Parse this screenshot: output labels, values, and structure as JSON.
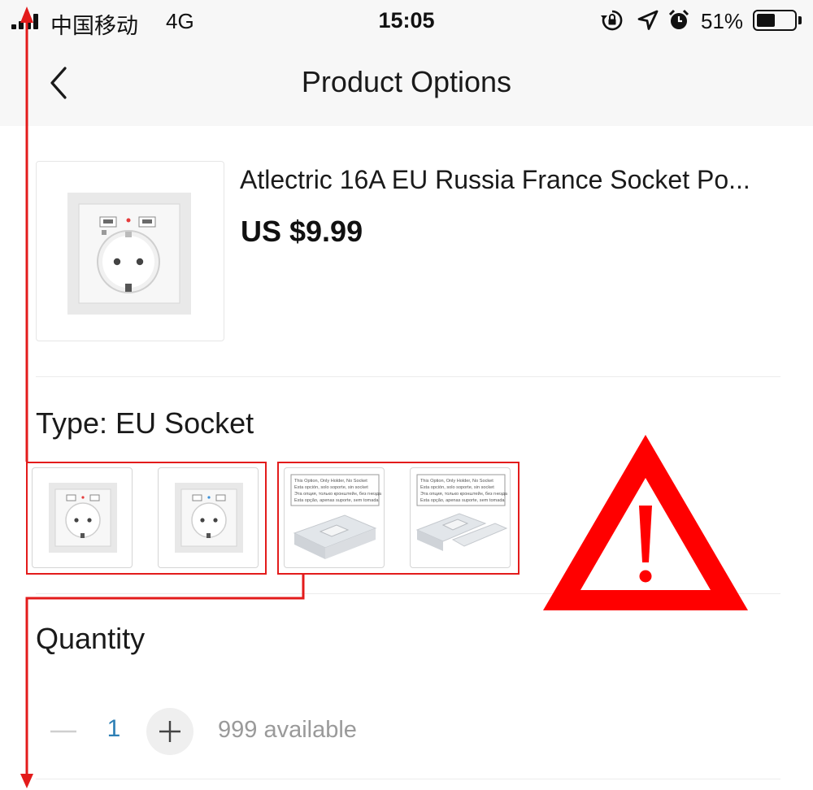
{
  "status_bar": {
    "carrier": "中国移动",
    "network": "4G",
    "time": "15:05",
    "battery_percent": "51%",
    "battery_level": 0.51,
    "icons": [
      "signal-icon",
      "rotation-lock-icon",
      "location-arrow-icon",
      "alarm-icon",
      "battery-icon"
    ]
  },
  "nav": {
    "title": "Product Options",
    "back_icon": "chevron-left-icon"
  },
  "product": {
    "title": "Atlectric 16A EU Russia France Socket Po...",
    "price": "US $9.99"
  },
  "type_selector": {
    "label": "Type: EU Socket",
    "options": [
      {
        "kind": "socket",
        "name": "option-eu-socket-1"
      },
      {
        "kind": "socket",
        "name": "option-eu-socket-2"
      },
      {
        "kind": "holder",
        "name": "option-holder-only-1",
        "notice_lines": [
          "This Option, Only Holder, No Socket",
          "Esta opción, solo soporte, sin socket",
          "Эта опция, только кронштейн, без гнезда",
          "Esta opção, apenas suporte, sem tomada"
        ]
      },
      {
        "kind": "holder",
        "name": "option-holder-only-2",
        "notice_lines": [
          "This Option, Only Holder, No Socket",
          "Esta opción, solo soporte, sin socket",
          "Эта опция, только кронштейн, без гнезда",
          "Esta opção, apenas suporte, sem tomada"
        ]
      }
    ]
  },
  "quantity": {
    "label": "Quantity",
    "value": "1",
    "available": "999 available"
  },
  "colors": {
    "annotation_red": "#e31b1b",
    "quantity_blue": "#2d7fb5",
    "bar_background": "#f7f7f7"
  }
}
